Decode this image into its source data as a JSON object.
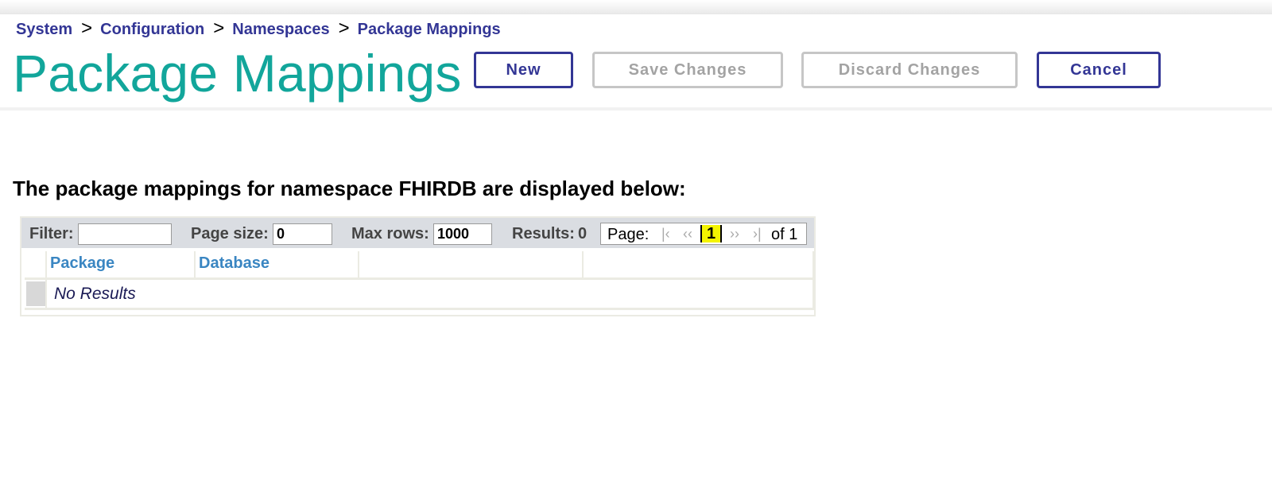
{
  "breadcrumb": {
    "items": [
      "System",
      "Configuration",
      "Namespaces",
      "Package Mappings"
    ],
    "separator": ">"
  },
  "page": {
    "title": "Package Mappings"
  },
  "buttons": {
    "new": "New",
    "save": "Save Changes",
    "discard": "Discard Changes",
    "cancel": "Cancel"
  },
  "description": "The package mappings for namespace FHIRDB are displayed below:",
  "toolbar": {
    "filter_label": "Filter:",
    "filter_value": "",
    "page_size_label": "Page size:",
    "page_size_value": "0",
    "max_rows_label": "Max rows:",
    "max_rows_value": "1000",
    "results_label": "Results:",
    "results_value": "0"
  },
  "pager": {
    "label": "Page:",
    "first": "|‹",
    "prev": "‹‹",
    "current": "1",
    "next": "››",
    "last": "›|",
    "of": "of 1"
  },
  "table": {
    "columns": [
      "Package",
      "Database",
      "",
      ""
    ],
    "empty_text": "No Results"
  },
  "colors": {
    "title": "#12a69b",
    "link": "#333695",
    "column_header": "#3a86c2",
    "current_page_highlight": "#f4f400"
  }
}
